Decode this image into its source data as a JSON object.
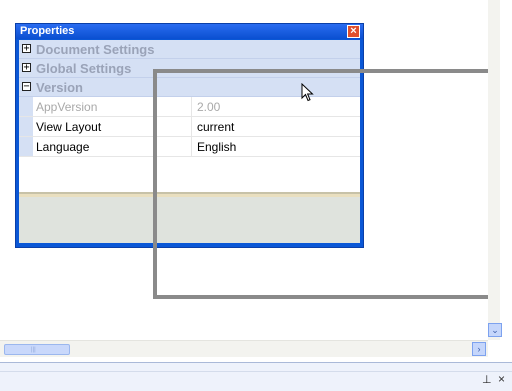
{
  "properties_window": {
    "title": "Properties",
    "categories": [
      {
        "label": "Document Settings",
        "expander": "⊞"
      },
      {
        "label": "Global Settings",
        "expander": "⊞"
      },
      {
        "label": "Version",
        "expander": "⊟"
      }
    ],
    "rows": [
      {
        "name": "AppVersion",
        "value": "2.00"
      },
      {
        "name": "View Layout",
        "value": "current"
      },
      {
        "name": "Language",
        "value": "English"
      }
    ]
  },
  "scroll": {
    "down_arrow": "⌄",
    "right_arrow": "›",
    "grip": "|||"
  },
  "bottom_panel": {
    "pin": "⊥",
    "close": "×"
  },
  "icons": [
    "close-icon",
    "expand-icon",
    "collapse-icon",
    "cursor-arrow-icon",
    "pin-icon",
    "close-x-icon"
  ],
  "colors": {
    "titlebar": "#0a57d6",
    "category_bg": "#d5e0f4",
    "close": "#e0502e"
  }
}
